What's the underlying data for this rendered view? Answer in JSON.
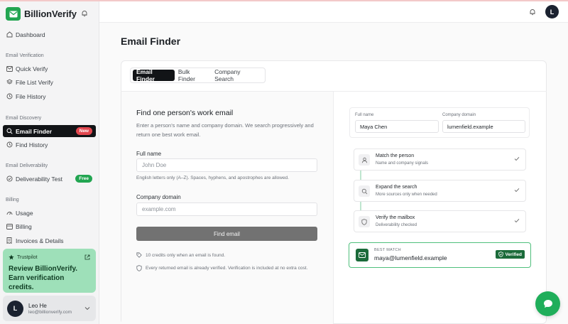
{
  "brand": {
    "name": "BillionVerify"
  },
  "sidebar": {
    "dashboard": "Dashboard",
    "sections": {
      "email_verification": "Email Verification",
      "email_discovery": "Email Discovery",
      "email_deliverability": "Email Deliverability",
      "billing": "Billing"
    },
    "items": {
      "quick_verify": "Quick Verify",
      "file_list_verify": "File List Verify",
      "file_history": "File History",
      "email_finder": "Email Finder",
      "email_finder_badge": "New",
      "find_history": "Find History",
      "deliverability_test": "Deliverability Test",
      "deliverability_badge": "Free",
      "usage": "Usage",
      "billing": "Billing",
      "invoices": "Invoices & Details"
    },
    "promo": {
      "source": "Trustpilot",
      "title": "Review BillionVerify. Earn verification credits."
    },
    "user": {
      "initial": "L",
      "name": "Leo He",
      "email": "leo@billionverify.com"
    }
  },
  "topbar": {
    "avatar_initial": "L"
  },
  "page": {
    "title": "Email Finder"
  },
  "tabs": [
    "Email Finder",
    "Bulk Finder",
    "Company Search"
  ],
  "form": {
    "title": "Find one person's work email",
    "description": "Enter a person's name and company domain. We search progressively and return one best work email.",
    "full_name_label": "Full name",
    "full_name_placeholder": "John Doe",
    "name_hint": "English letters only (A–Z). Spaces, hyphens, and apostrophes are allowed.",
    "domain_label": "Company domain",
    "domain_placeholder": "example.com",
    "submit": "Find email",
    "note_credits": "10 credits only when an email is found.",
    "note_verified": "Every returned email is already verified. Verification is included at no extra cost."
  },
  "demo": {
    "full_name_label": "Full name",
    "full_name_value": "Maya Chen",
    "domain_label": "Company domain",
    "domain_value": "lumenfield.example",
    "steps": [
      {
        "title": "Match the person",
        "subtitle": "Name and company signals",
        "icon": "person-icon"
      },
      {
        "title": "Expand the search",
        "subtitle": "More sources only when needed",
        "icon": "search-icon"
      },
      {
        "title": "Verify the mailbox",
        "subtitle": "Deliverability checked",
        "icon": "shield-icon"
      }
    ],
    "result": {
      "label": "BEST MATCH",
      "email": "maya@lumenfield.example",
      "badge": "Verified"
    }
  },
  "colors": {
    "brand_green": "#22a551",
    "active_nav": "#121417",
    "new_badge": "#e2474f",
    "promo_bg": "#9ee0b9",
    "verified_green": "#1b6b3a"
  }
}
